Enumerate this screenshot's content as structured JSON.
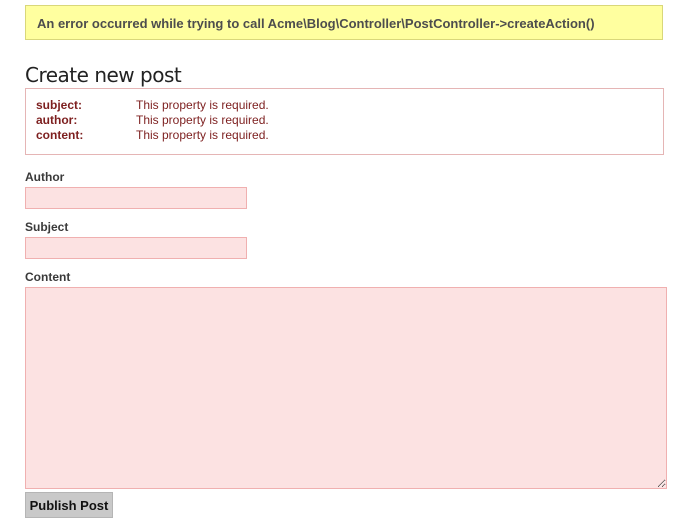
{
  "flash": {
    "error_message": "An error occurred while trying to call Acme\\Blog\\Controller\\PostController->createAction()"
  },
  "page": {
    "title": "Create new post"
  },
  "validation": {
    "errors": [
      {
        "field": "subject:",
        "message": "This property is required."
      },
      {
        "field": "author:",
        "message": "This property is required."
      },
      {
        "field": "content:",
        "message": "This property is required."
      }
    ]
  },
  "form": {
    "author": {
      "label": "Author",
      "value": ""
    },
    "subject": {
      "label": "Subject",
      "value": ""
    },
    "content": {
      "label": "Content",
      "value": ""
    },
    "submit_label": "Publish Post"
  },
  "colors": {
    "flash_background": "#ffff9f",
    "error_text": "#7d1f1f",
    "invalid_field_background": "#fce2e2",
    "invalid_field_border": "#f0b0b0"
  }
}
